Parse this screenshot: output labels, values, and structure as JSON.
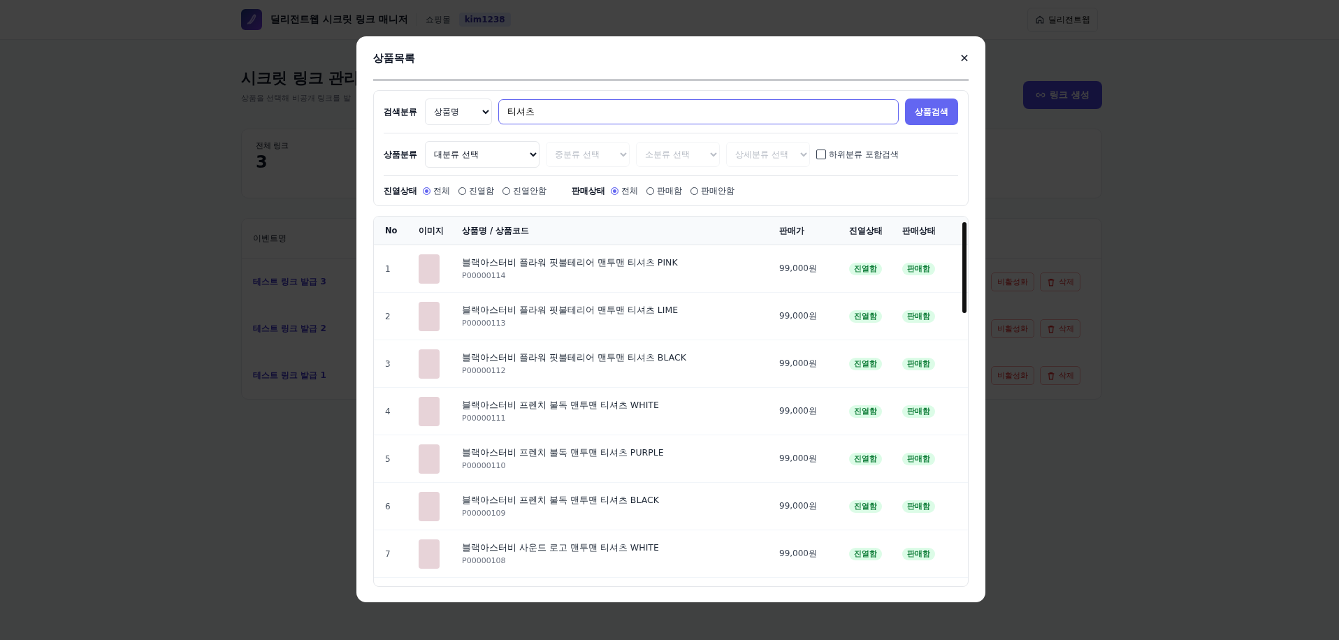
{
  "header": {
    "title": "딜리전트웹 시크릿 링크 매니저",
    "mall_label": "쇼핑몰",
    "mall_id": "kim1238",
    "home_button": "딜리전트웹"
  },
  "page": {
    "title": "시크릿 링크 관리",
    "subtitle": "상품을 선택해 비공개 링크를 발",
    "create_button": "링크 생성"
  },
  "stats": [
    {
      "label": "전체 링크",
      "value": "3"
    }
  ],
  "links": {
    "columns": [
      "이벤트명"
    ],
    "rows": [
      {
        "event": "테스트 링크 발급 3",
        "deactivate": "비활성화",
        "delete": "삭제"
      },
      {
        "event": "테스트 링크 발급 2",
        "deactivate": "비활성화",
        "delete": "삭제"
      },
      {
        "event": "테스트 링크 발급 1",
        "deactivate": "비활성화",
        "delete": "삭제"
      }
    ]
  },
  "modal": {
    "title": "상품목록",
    "search": {
      "label": "검색분류",
      "type": "상품명",
      "value": "티셔츠",
      "button": "상품검색"
    },
    "category": {
      "label": "상품분류",
      "selects": [
        {
          "text": "대분류 선택",
          "disabled": false
        },
        {
          "text": "중분류 선택",
          "disabled": true
        },
        {
          "text": "소분류 선택",
          "disabled": true
        },
        {
          "text": "상세분류 선택",
          "disabled": true
        }
      ],
      "include_sub": {
        "label": "하위분류 포함검색",
        "checked": false
      }
    },
    "status_filters": [
      {
        "label": "진열상태",
        "options": [
          {
            "label": "전체",
            "selected": true
          },
          {
            "label": "진열함",
            "selected": false
          },
          {
            "label": "진열안함",
            "selected": false
          }
        ]
      },
      {
        "label": "판매상태",
        "options": [
          {
            "label": "전체",
            "selected": true
          },
          {
            "label": "판매함",
            "selected": false
          },
          {
            "label": "판매안함",
            "selected": false
          }
        ]
      }
    ],
    "table": {
      "columns": [
        "No",
        "이미지",
        "상품명 / 상품코드",
        "판매가",
        "진열상태",
        "판매상태"
      ],
      "rows": [
        {
          "no": "1",
          "name": "블랙아스터비 플라워 핏불테리어 맨투맨 티셔츠 PINK",
          "code": "P00000114",
          "price": "99,000원",
          "display": "진열함",
          "sale": "판매함"
        },
        {
          "no": "2",
          "name": "블랙아스터비 플라워 핏불테리어 맨투맨 티셔츠 LIME",
          "code": "P00000113",
          "price": "99,000원",
          "display": "진열함",
          "sale": "판매함"
        },
        {
          "no": "3",
          "name": "블랙아스터비 플라워 핏불테리어 맨투맨 티셔츠 BLACK",
          "code": "P00000112",
          "price": "99,000원",
          "display": "진열함",
          "sale": "판매함"
        },
        {
          "no": "4",
          "name": "블랙아스터비 프렌치 불독 맨투맨 티셔츠 WHITE",
          "code": "P00000111",
          "price": "99,000원",
          "display": "진열함",
          "sale": "판매함"
        },
        {
          "no": "5",
          "name": "블랙아스터비 프렌치 불독 맨투맨 티셔츠 PURPLE",
          "code": "P00000110",
          "price": "99,000원",
          "display": "진열함",
          "sale": "판매함"
        },
        {
          "no": "6",
          "name": "블랙아스터비 프렌치 불독 맨투맨 티셔츠 BLACK",
          "code": "P00000109",
          "price": "99,000원",
          "display": "진열함",
          "sale": "판매함"
        },
        {
          "no": "7",
          "name": "블랙아스터비 사운드 로고 맨투맨 티셔츠 WHITE",
          "code": "P00000108",
          "price": "99,000원",
          "display": "진열함",
          "sale": "판매함"
        }
      ]
    }
  }
}
